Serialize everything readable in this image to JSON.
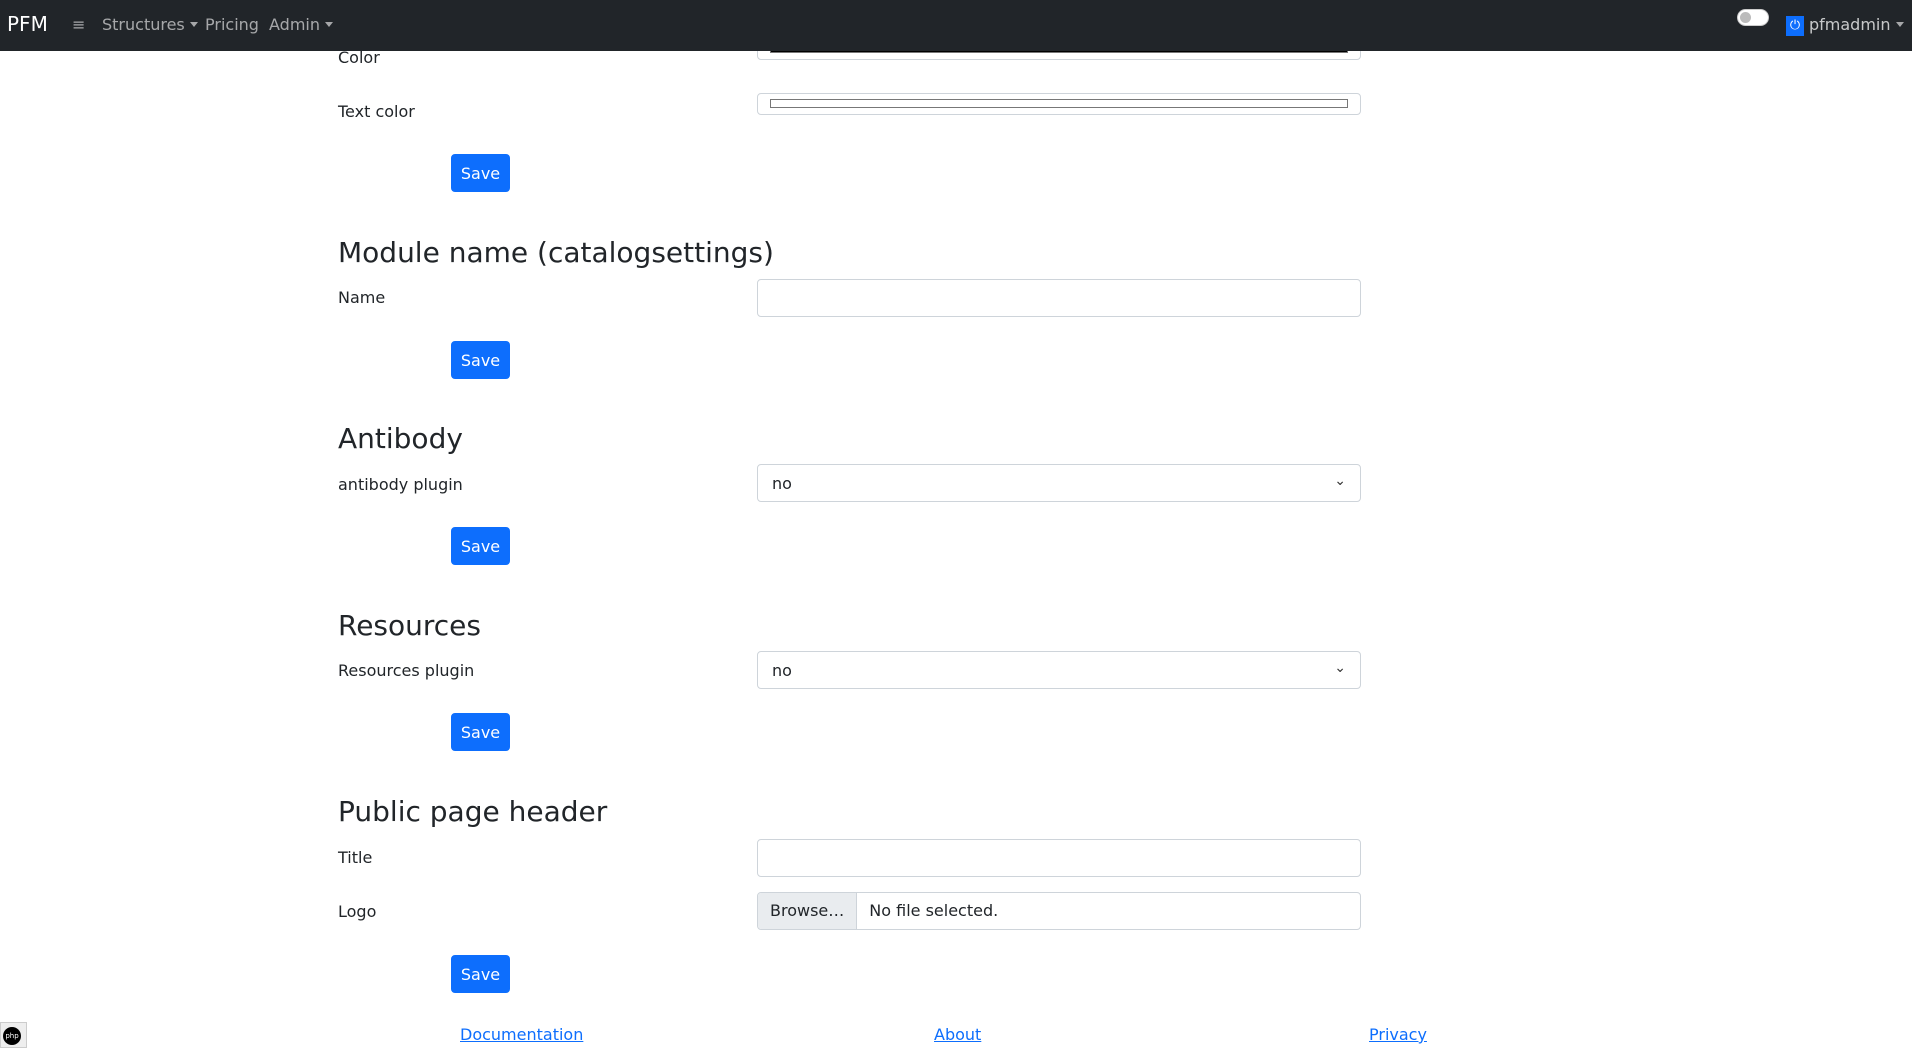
{
  "navbar": {
    "brand": "PFM",
    "menu_icon": "≡",
    "items": [
      "Structures",
      "Pricing",
      "Admin"
    ],
    "user": "pfmadmin",
    "user_icon": "⏻"
  },
  "sections": {
    "colors": {
      "color_label": "Color",
      "text_color_label": "Text color",
      "save": "Save"
    },
    "module": {
      "heading": "Module name (catalogsettings)",
      "name_label": "Name",
      "name_value": "",
      "save": "Save"
    },
    "antibody": {
      "heading": "Antibody",
      "label": "antibody plugin",
      "value": "no",
      "save": "Save"
    },
    "resources": {
      "heading": "Resources",
      "label": "Resources plugin",
      "value": "no",
      "save": "Save"
    },
    "public": {
      "heading": "Public page header",
      "title_label": "Title",
      "title_value": "",
      "logo_label": "Logo",
      "browse": "Browse…",
      "no_file": "No file selected.",
      "save": "Save"
    }
  },
  "footer": {
    "links": [
      "Documentation",
      "About",
      "Privacy"
    ],
    "badge": "php"
  }
}
